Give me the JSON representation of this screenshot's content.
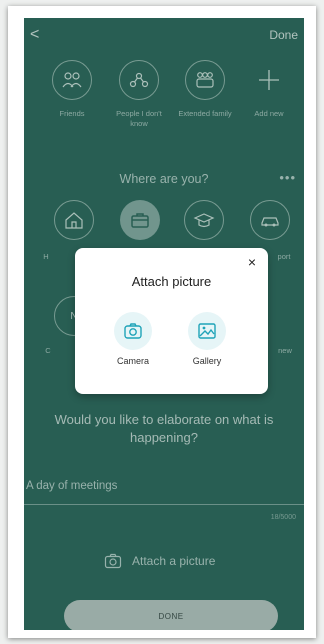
{
  "header": {
    "back_label": "<",
    "done_label": "Done"
  },
  "who": {
    "items": [
      {
        "label": "Friends",
        "icon": "friends-icon"
      },
      {
        "label": "People I don't know",
        "icon": "network-icon"
      },
      {
        "label": "Extended family",
        "icon": "family-icon"
      },
      {
        "label": "Add new",
        "icon": "plus-icon"
      }
    ]
  },
  "where": {
    "title": "Where are you?",
    "more_label": "•••",
    "items": [
      {
        "label": "H",
        "icon": "home-icon"
      },
      {
        "label": "",
        "icon": "briefcase-icon"
      },
      {
        "label": "",
        "icon": "graduation-cap-icon"
      },
      {
        "label": "port",
        "icon": "car-icon"
      }
    ],
    "row2_partial_labels": {
      "left": "C",
      "left_circle": "N",
      "right": "new"
    }
  },
  "question": "Would you like to elaborate on what is happening?",
  "entry": {
    "value": "A day of meetings",
    "counter": "18/5000"
  },
  "attach": {
    "label": "Attach a picture",
    "icon": "camera-icon"
  },
  "done_button": "DONE",
  "modal": {
    "title": "Attach picture",
    "close_label": "×",
    "options": [
      {
        "label": "Camera",
        "icon": "camera-icon"
      },
      {
        "label": "Gallery",
        "icon": "gallery-icon"
      }
    ]
  },
  "colors": {
    "screen_bg": "#2f6b5e",
    "accent": "#1fa3b8"
  }
}
